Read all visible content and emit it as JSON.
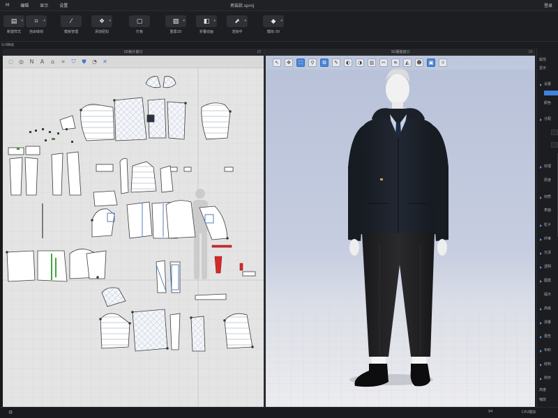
{
  "window": {
    "menu_left": "M",
    "title": "男装款.sproj",
    "menu_right": "登录"
  },
  "menu": [
    "编辑",
    "显示",
    "设置"
  ],
  "toolbar": [
    {
      "label": "新建样式",
      "icon": "new-icon"
    },
    {
      "label": "自由缝纫",
      "icon": "sew-icon"
    },
    {
      "label": "模板管理",
      "icon": "template-icon"
    },
    {
      "label": "添加纽扣",
      "icon": "button-icon"
    },
    {
      "label": "打板",
      "icon": "pattern-icon"
    },
    {
      "label": "重置2D",
      "icon": "reset-2d-icon"
    },
    {
      "label": "折叠动画",
      "icon": "fold-icon"
    },
    {
      "label": "渲染中",
      "icon": "render-icon"
    },
    {
      "label": "模拟-30",
      "icon": "simulate-icon"
    }
  ],
  "breadcrumb": "5/3种绩",
  "panels": {
    "pattern_2d": {
      "title": "2D板片窗口"
    },
    "viewer_3d": {
      "title": "3D服装窗口"
    }
  },
  "tools_2d": [
    "select-icon",
    "transform-icon",
    "line-icon",
    "text-icon",
    "rect-icon",
    "pin-icon",
    "cut-icon",
    "sewing-icon",
    "fold-icon",
    "trim-icon"
  ],
  "tools_3d": [
    "select-icon",
    "move-icon",
    "fit-icon",
    "pin-icon",
    "arrange-icon",
    "brush-icon",
    "tape-icon",
    "fold-icon",
    "press-icon",
    "cut-icon",
    "steam-icon",
    "garment-icon",
    "avatar-icon",
    "camera-icon",
    "light-icon"
  ],
  "sidebar": {
    "header": "属性",
    "tab": "显示",
    "items": [
      "设置",
      "颜色",
      "分配",
      "纹理",
      "厚度",
      "材质",
      "表面",
      "粒子",
      "纤维",
      "光泽",
      "透明",
      "图案",
      "提示",
      "高级",
      "测量",
      "报告",
      "布料",
      "结构",
      "附件",
      "视图",
      "效果"
    ],
    "footer": [
      "高度",
      "缩放"
    ]
  },
  "status": {
    "left": "⚙",
    "zoom_label": "CPU模拟",
    "count": "94"
  },
  "colors": {
    "accent": "#3f82e0",
    "selected_piece": "#d22a2a"
  }
}
